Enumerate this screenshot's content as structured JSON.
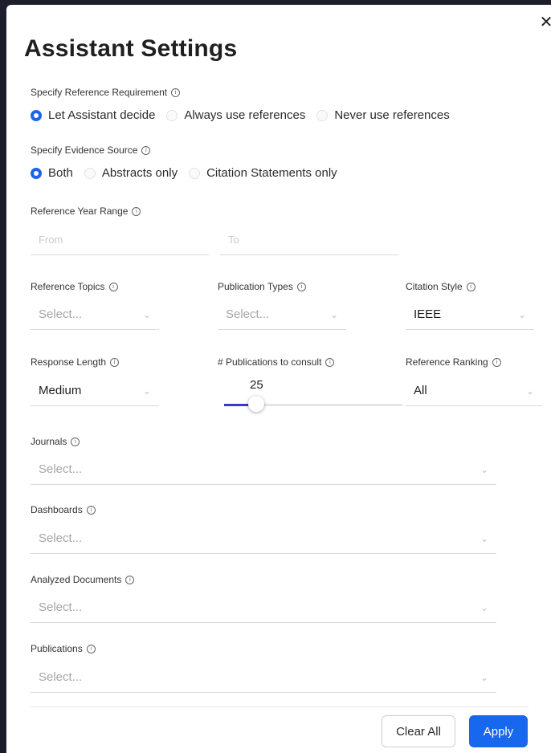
{
  "modal": {
    "title": "Assistant Settings",
    "close_icon": "close-icon"
  },
  "reference_requirement": {
    "label": "Specify Reference Requirement",
    "options": [
      "Let Assistant decide",
      "Always use references",
      "Never use references"
    ],
    "selected": "Let Assistant decide"
  },
  "evidence_source": {
    "label": "Specify Evidence Source",
    "options": [
      "Both",
      "Abstracts only",
      "Citation Statements only"
    ],
    "selected": "Both"
  },
  "year_range": {
    "label": "Reference Year Range",
    "from_placeholder": "From",
    "to_placeholder": "To"
  },
  "reference_topics": {
    "label": "Reference Topics",
    "placeholder": "Select..."
  },
  "publication_types": {
    "label": "Publication Types",
    "placeholder": "Select..."
  },
  "citation_style": {
    "label": "Citation Style",
    "value": "IEEE"
  },
  "response_length": {
    "label": "Response Length",
    "value": "Medium"
  },
  "publications_to_consult": {
    "label": "# Publications to consult",
    "value": "25",
    "fill_fraction": 0.15
  },
  "reference_ranking": {
    "label": "Reference Ranking",
    "value": "All"
  },
  "journals": {
    "label": "Journals",
    "placeholder": "Select..."
  },
  "dashboards": {
    "label": "Dashboards",
    "placeholder": "Select..."
  },
  "analyzed_documents": {
    "label": "Analyzed Documents",
    "placeholder": "Select..."
  },
  "publications": {
    "label": "Publications",
    "placeholder": "Select..."
  },
  "footer": {
    "clear_label": "Clear All",
    "apply_label": "Apply"
  },
  "colors": {
    "accent": "#1767ef",
    "slider_fill": "#3a39cf"
  }
}
